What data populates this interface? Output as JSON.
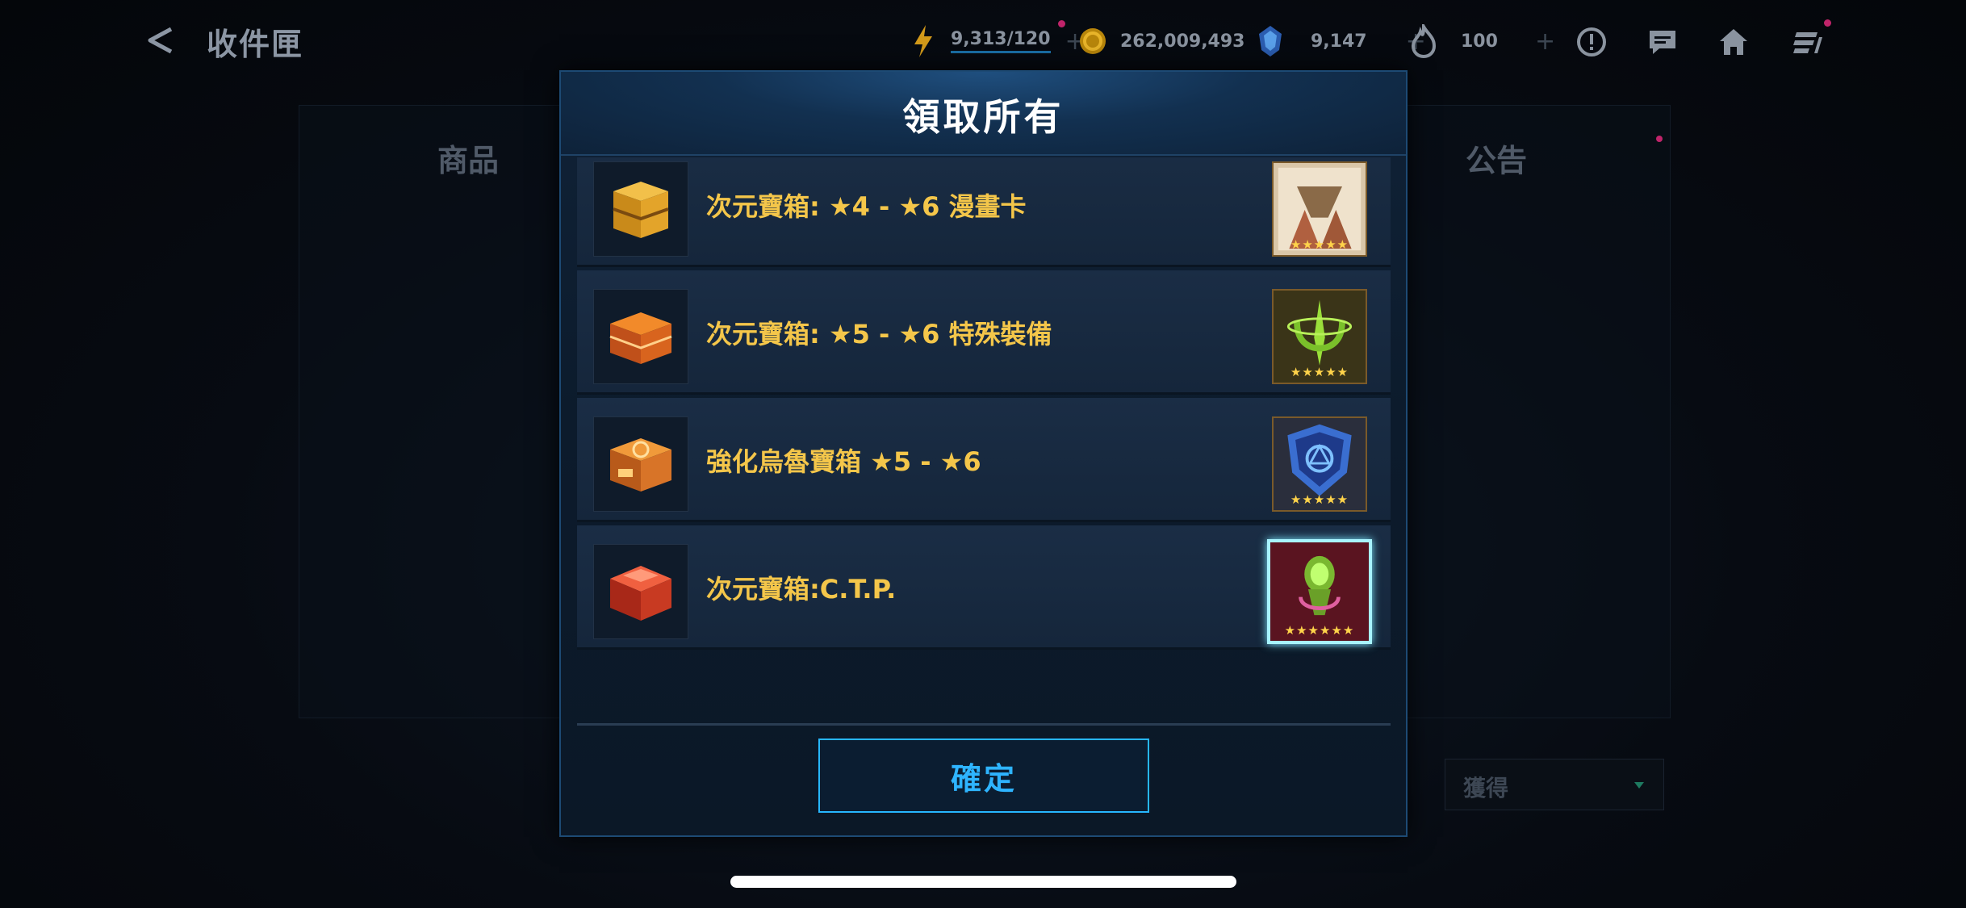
{
  "header": {
    "back_icon": "back-arrow-icon",
    "title": "收件匣",
    "resources": [
      {
        "name": "energy",
        "icon": "lightning-icon",
        "value": "9,313/120"
      },
      {
        "name": "gold",
        "icon": "gold-coin-icon",
        "value": "262,009,493"
      },
      {
        "name": "crystal",
        "icon": "crystal-icon",
        "value": "9,147"
      },
      {
        "name": "fire",
        "icon": "flame-icon",
        "value": "100"
      }
    ],
    "plus_symbol": "+",
    "icons": [
      "alert-icon",
      "chat-icon",
      "home-icon",
      "menu-icon"
    ]
  },
  "background": {
    "tab_left": "商品",
    "tab_right": "公告",
    "dropdown_label": "獲得"
  },
  "modal": {
    "title": "領取所有",
    "items": [
      {
        "label": "次元寶箱: ★4 - ★6 漫畫卡",
        "reward_stars": "★★★★★",
        "chest_icon": "gold-chest-icon",
        "reward_icon": "comic-card-icon"
      },
      {
        "label": "次元寶箱: ★5 - ★6 特殊裝備",
        "reward_stars": "★★★★★",
        "chest_icon": "orange-chest-icon",
        "reward_icon": "green-gear-icon"
      },
      {
        "label": "強化烏魯寶箱 ★5 - ★6",
        "reward_stars": "★★★★★",
        "chest_icon": "uru-chest-icon",
        "reward_icon": "blue-shield-icon"
      },
      {
        "label": "次元寶箱:C.T.P.",
        "reward_stars": "★★★★★★",
        "chest_icon": "red-chest-icon",
        "reward_icon": "ctp-icon"
      }
    ],
    "confirm_label": "確定"
  },
  "colors": {
    "accent": "#2eb4ff",
    "label_gold": "#f4c64a",
    "notification_dot": "#c0246a"
  }
}
